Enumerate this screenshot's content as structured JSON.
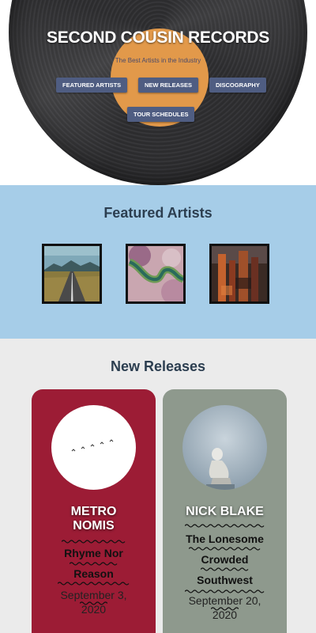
{
  "header": {
    "title": "SECOND COUSIN RECORDS",
    "tagline": "The Best Artists in the Industry",
    "nav": [
      {
        "label": "FEATURED ARTISTS"
      },
      {
        "label": "NEW RELEASES"
      },
      {
        "label": "DISCOGRAPHY"
      },
      {
        "label": "TOUR SCHEDULES"
      }
    ]
  },
  "featured": {
    "title": "Featured Artists",
    "artists": [
      {
        "image": "road-landscape"
      },
      {
        "image": "river-aerial"
      },
      {
        "image": "abstract-painting"
      }
    ]
  },
  "releases": {
    "title": "New Releases",
    "items": [
      {
        "artist_line1": "METRO",
        "artist_line2": "NOMIS",
        "album_line1": "Rhyme Nor",
        "album_line2": "Reason",
        "date_line1": "September 3,",
        "date_line2": "2020",
        "card_color": "#9c1c35"
      },
      {
        "artist_line1": "NICK BLAKE",
        "album_line1": "The Lonesome",
        "album_line2": "Crowded",
        "album_line3": "Southwest",
        "date_line1": "September 20,",
        "date_line2": "2020",
        "card_color": "#8e998d"
      }
    ]
  },
  "colors": {
    "nav_button": "#4f5d82",
    "vinyl_label": "#e2994a",
    "featured_bg": "#a6cde8",
    "page_bg": "#ebebeb"
  }
}
